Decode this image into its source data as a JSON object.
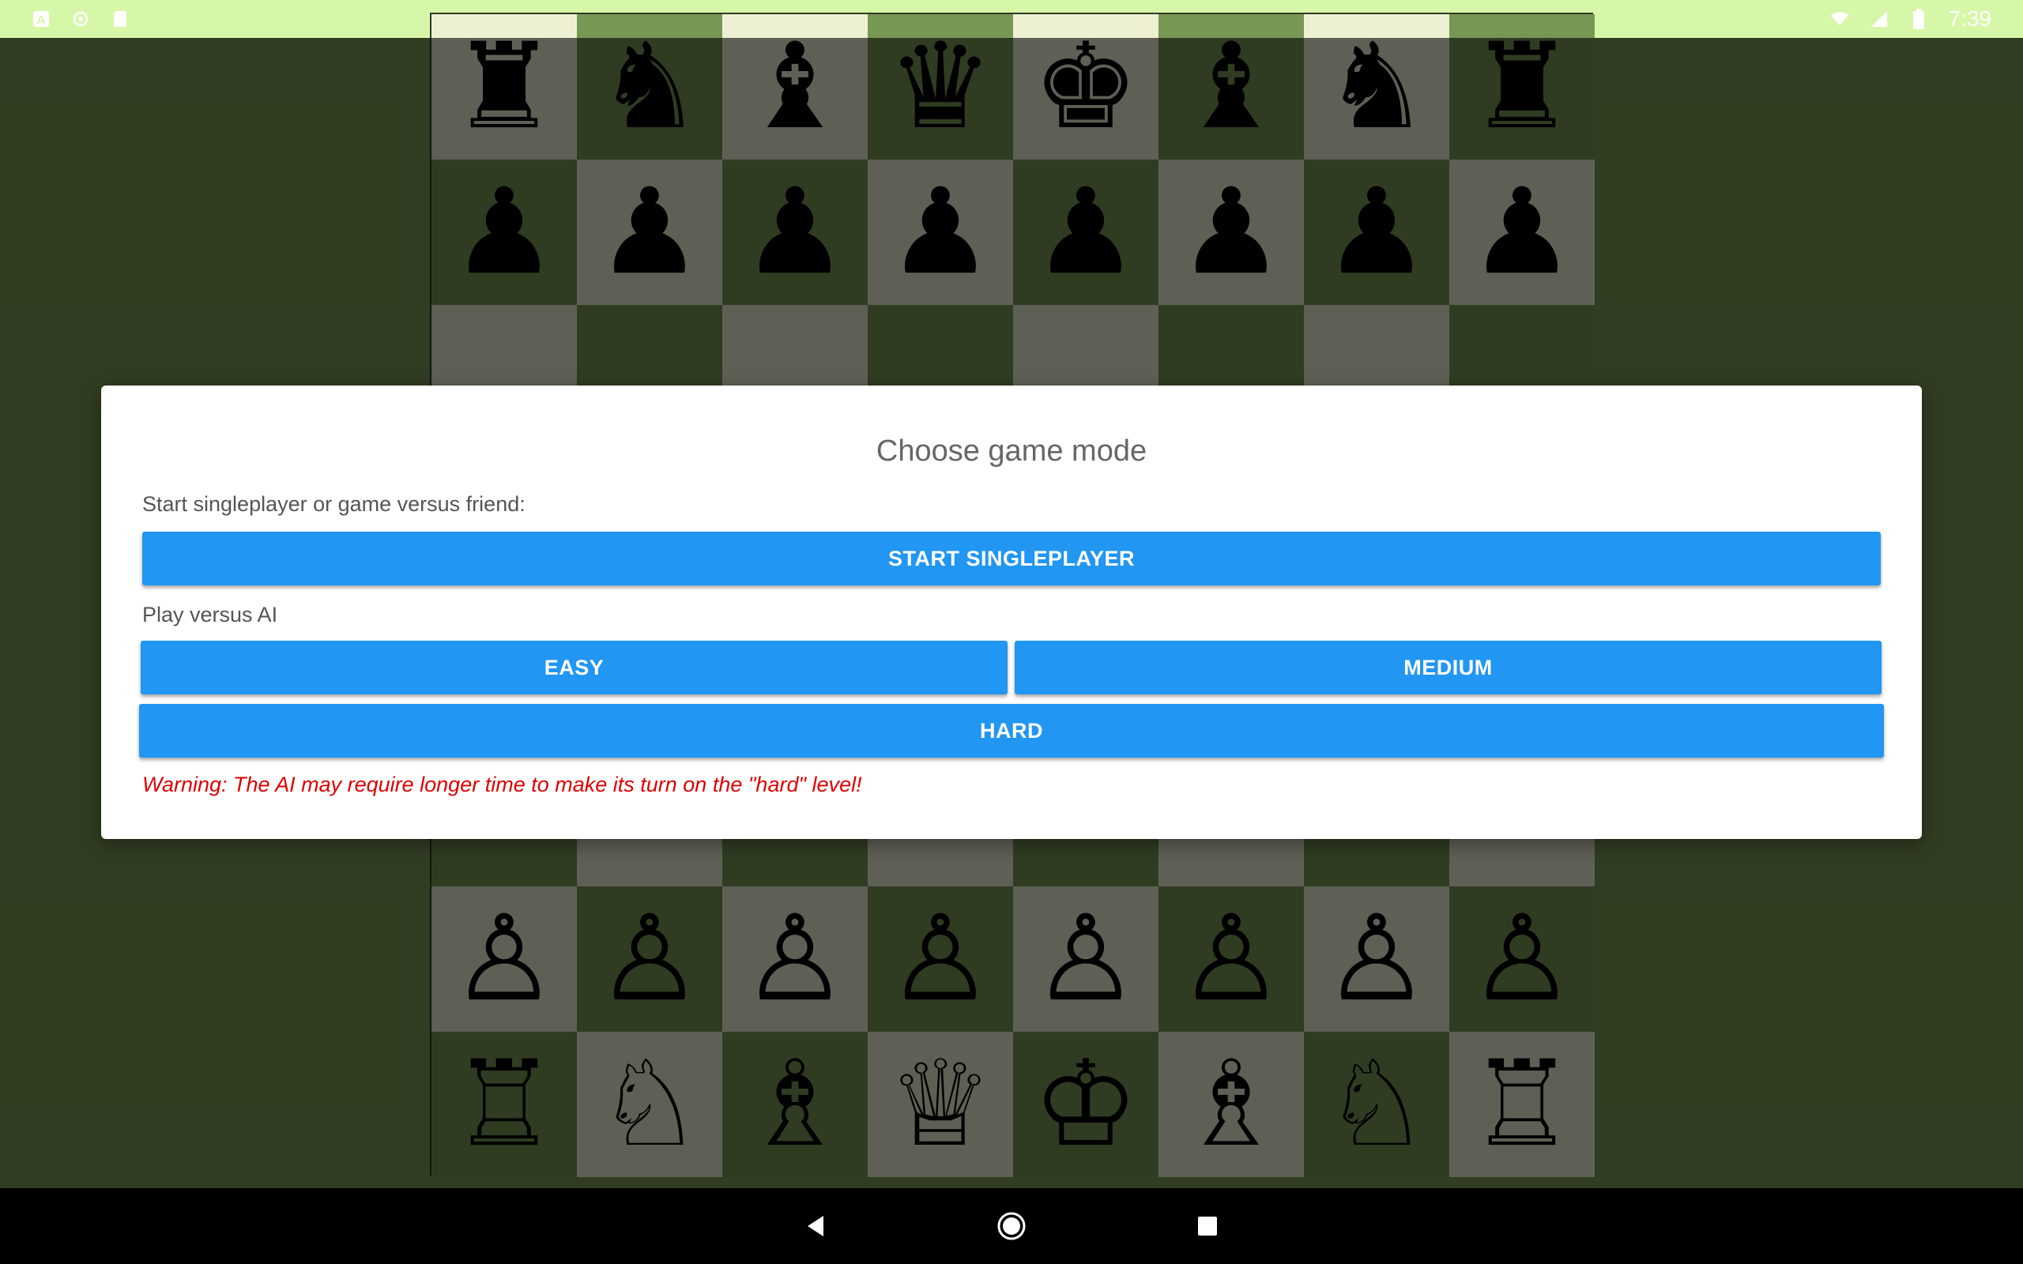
{
  "status_bar": {
    "left_icons": [
      "a-icon",
      "sync-icon",
      "sd-card-icon"
    ],
    "right_icons": [
      "wifi-icon",
      "signal-icon",
      "battery-icon"
    ],
    "time": "7:39"
  },
  "board": {
    "rank8": [
      "♜",
      "♞",
      "♝",
      "♛",
      "♚",
      "♝",
      "♞",
      "♜"
    ],
    "rank7": [
      "♟",
      "♟",
      "♟",
      "♟",
      "♟",
      "♟",
      "♟",
      "♟"
    ],
    "rank2": [
      "♙",
      "♙",
      "♙",
      "♙",
      "♙",
      "♙",
      "♙",
      "♙"
    ],
    "rank1": [
      "♖",
      "♘",
      "♗",
      "♕",
      "♔",
      "♗",
      "♘",
      "♖"
    ]
  },
  "dialog": {
    "title": "Choose game mode",
    "singleplayer_label": "Start singleplayer or game versus friend:",
    "start_singleplayer": "START SINGLEPLAYER",
    "ai_label": "Play versus AI",
    "easy": "EASY",
    "medium": "MEDIUM",
    "hard": "HARD",
    "warning": "Warning: The AI may require longer time to make its turn on the \"hard\" level!"
  },
  "nav_bar": {
    "buttons": [
      "back-icon",
      "home-icon",
      "recents-icon"
    ]
  },
  "colors": {
    "accent": "#2196f3",
    "warning": "#e00000",
    "board_light": "#eef0d4",
    "board_dark": "#779755"
  }
}
